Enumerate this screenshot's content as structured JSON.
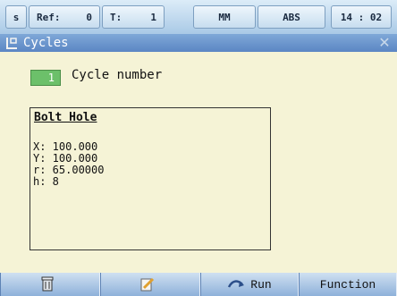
{
  "statusbar": {
    "mode": "s",
    "ref_label": "Ref:",
    "ref_value": "0",
    "tool_label": "T:",
    "tool_value": "1",
    "units": "MM",
    "abs_label": "ABS",
    "time": "14 : 02"
  },
  "window": {
    "title": "Cycles",
    "icon": "cycles-icon",
    "close_icon": "close-icon"
  },
  "cycle": {
    "number_value": "1",
    "number_label": "Cycle number"
  },
  "bolt_hole": {
    "title": "Bolt Hole",
    "x": "X: 100.000",
    "y": "Y: 100.000",
    "r": "r: 65.00000",
    "h": "h: 8"
  },
  "softkeys": [
    {
      "icon": "trash-icon",
      "label": ""
    },
    {
      "icon": "edit-icon",
      "label": ""
    },
    {
      "icon": "run-icon",
      "label": "Run"
    },
    {
      "icon": "",
      "label": "Function"
    }
  ],
  "colors": {
    "background": "#f5f3d6",
    "titlebar": "#5b86c4",
    "cycle_field": "#6cc06a",
    "softkey_bar": "#7fa3d0"
  }
}
